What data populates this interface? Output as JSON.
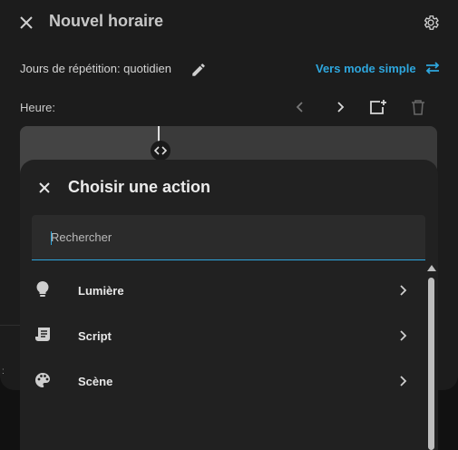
{
  "dialog": {
    "title": "Nouvel horaire",
    "repeat_label": "Jours de répétition: quotidien",
    "mode_link": "Vers mode simple",
    "hour_label": "Heure:"
  },
  "sheet": {
    "title": "Choisir une action",
    "search_placeholder": "Rechercher",
    "items": [
      {
        "label": "Lumière",
        "icon": "lightbulb-icon"
      },
      {
        "label": "Script",
        "icon": "script-icon"
      },
      {
        "label": "Scène",
        "icon": "palette-icon"
      }
    ]
  },
  "colors": {
    "accent": "#2ea6dd",
    "dialog_bg": "#1c1c1c",
    "sheet_bg": "#212121"
  }
}
